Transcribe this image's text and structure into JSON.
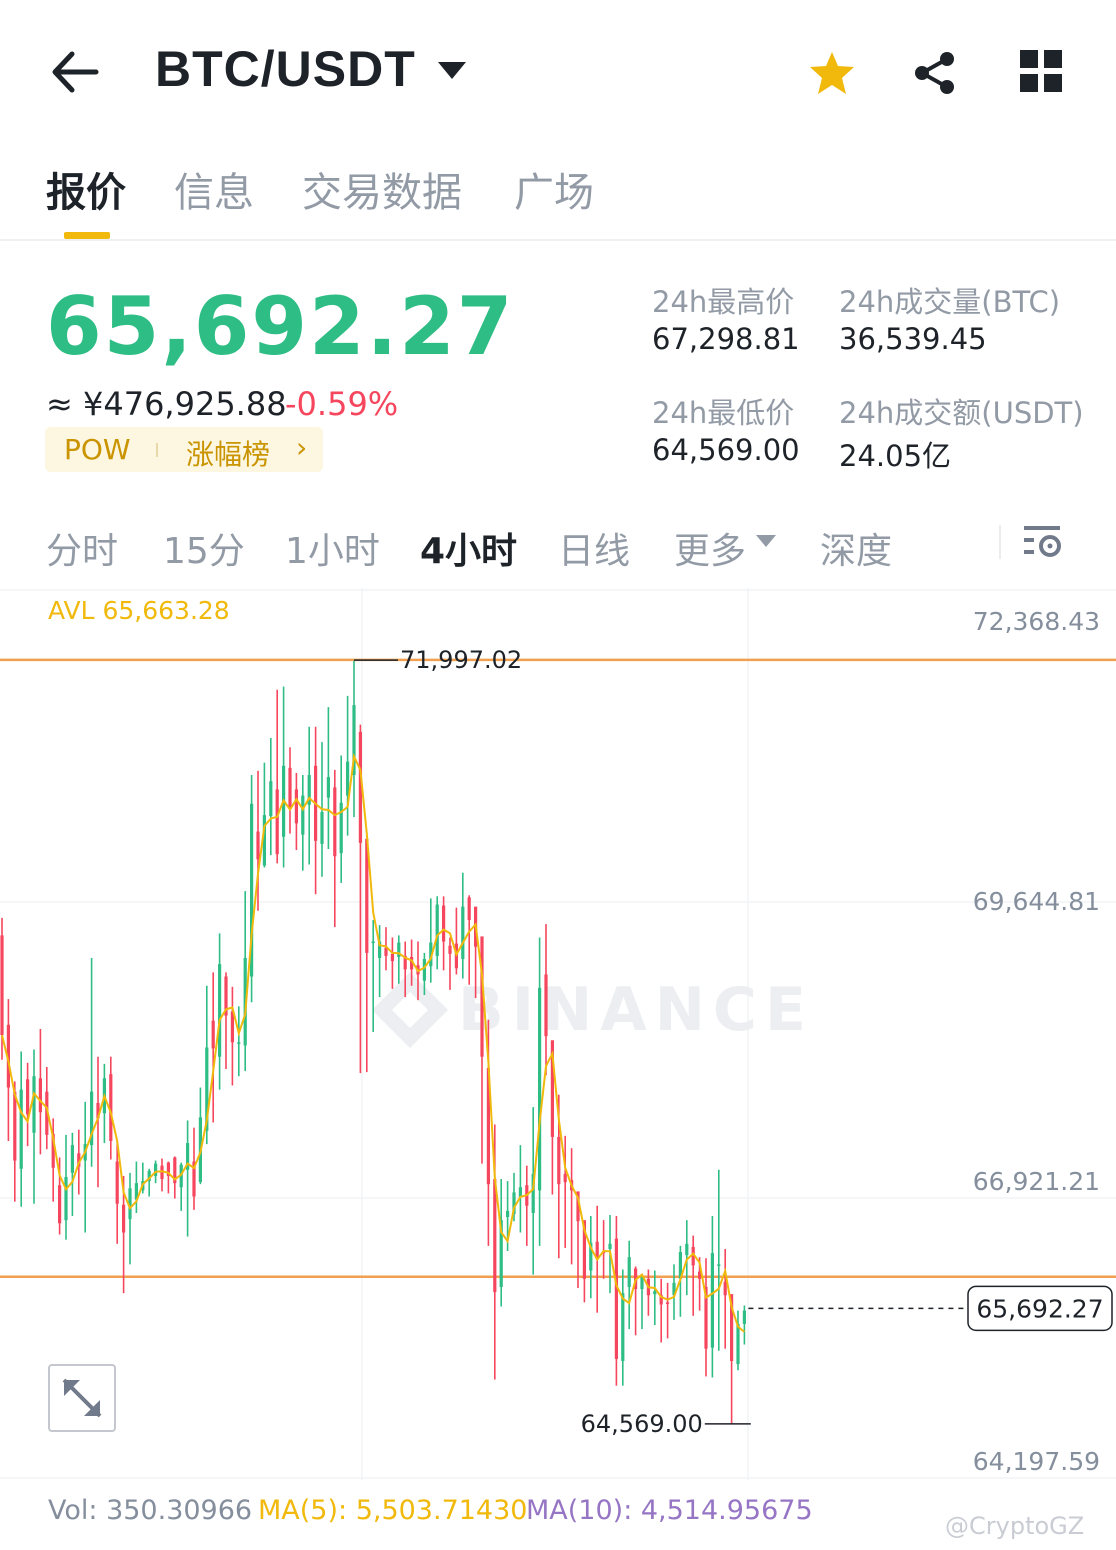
{
  "header": {
    "back_icon": "arrow-left-icon",
    "pair": "BTC/USDT",
    "dropdown_icon": "caret-down-icon",
    "favorite_icon": "star-icon",
    "share_icon": "share-icon",
    "menu_icon": "grid-icon",
    "favorite_color": "#f0b90b"
  },
  "tabs": [
    {
      "label": "报价",
      "active": true
    },
    {
      "label": "信息",
      "active": false
    },
    {
      "label": "交易数据",
      "active": false
    },
    {
      "label": "广场",
      "active": false
    }
  ],
  "ticker": {
    "last_price": "65,692.27",
    "approx_cny": "≈ ¥476,925.88",
    "change_pct": "-0.59%",
    "tag_pow": "POW",
    "tag_gainers": "涨幅榜",
    "tag_arrow": "›",
    "high_label": "24h最高价",
    "high_value": "67,298.81",
    "vol_btc_label": "24h成交量(BTC)",
    "vol_btc_value": "36,539.45",
    "low_label": "24h最低价",
    "low_value": "64,569.00",
    "vol_usdt_label": "24h成交额(USDT)",
    "vol_usdt_value": "24.05亿",
    "up_color": "#2ebd85",
    "down_color": "#f6465d"
  },
  "intervals": [
    {
      "label": "分时",
      "active": false
    },
    {
      "label": "15分",
      "active": false
    },
    {
      "label": "1小时",
      "active": false
    },
    {
      "label": "4小时",
      "active": true
    },
    {
      "label": "日线",
      "active": false
    },
    {
      "label": "更多",
      "active": false
    },
    {
      "label": "深度",
      "active": false
    }
  ],
  "chart_settings_icon": "chart-settings-icon",
  "chart_data": {
    "type": "candlestick",
    "avl_label": "AVL 65,663.28",
    "y_ticks": [
      "72,368.43",
      "69,644.81",
      "66,921.21",
      "64,197.59"
    ],
    "ylim": [
      64197.59,
      72368.43
    ],
    "high_marker": "71,997.02",
    "low_marker": "64,569.00",
    "current_price": "65,692.27",
    "watermark": "BINANCE",
    "candles": [
      [
        69320,
        68350,
        69490,
        68110
      ],
      [
        68450,
        67840,
        68700,
        67320
      ],
      [
        67800,
        67130,
        67900,
        66730
      ],
      [
        67050,
        67820,
        68190,
        66680
      ],
      [
        67920,
        67580,
        68080,
        67270
      ],
      [
        67400,
        67950,
        68210,
        66710
      ],
      [
        67930,
        67600,
        68410,
        67190
      ],
      [
        67800,
        67380,
        68040,
        67240
      ],
      [
        67390,
        67060,
        67540,
        66730
      ],
      [
        66890,
        66520,
        67160,
        66410
      ],
      [
        66550,
        66970,
        67380,
        66360
      ],
      [
        67010,
        67280,
        67400,
        66590
      ],
      [
        67200,
        67070,
        67430,
        66800
      ],
      [
        67130,
        67290,
        67700,
        66430
      ],
      [
        67280,
        67800,
        69100,
        67070
      ],
      [
        67690,
        67540,
        68140,
        66870
      ],
      [
        67590,
        67930,
        68070,
        67300
      ],
      [
        67970,
        67320,
        68140,
        67140
      ],
      [
        67120,
        66710,
        67320,
        66320
      ],
      [
        66700,
        66430,
        66980,
        65840
      ],
      [
        66560,
        66860,
        67010,
        66120
      ],
      [
        66750,
        66910,
        67120,
        66620
      ],
      [
        66840,
        66930,
        67110,
        66810
      ],
      [
        66930,
        67030,
        67050,
        66780
      ],
      [
        66980,
        67100,
        67130,
        66910
      ],
      [
        67080,
        66950,
        67150,
        66830
      ],
      [
        67110,
        66980,
        67120,
        66810
      ],
      [
        67160,
        66910,
        67170,
        66760
      ],
      [
        66870,
        67090,
        67110,
        66640
      ],
      [
        67040,
        67300,
        67520,
        66390
      ],
      [
        67120,
        66780,
        67450,
        66650
      ],
      [
        66920,
        67550,
        67840,
        66900
      ],
      [
        67420,
        68230,
        68830,
        67290
      ],
      [
        68490,
        68220,
        68960,
        67500
      ],
      [
        68140,
        69040,
        69340,
        67820
      ],
      [
        68920,
        68540,
        68960,
        68020
      ],
      [
        68580,
        68280,
        68820,
        67860
      ],
      [
        68270,
        68280,
        68630,
        67950
      ],
      [
        68250,
        69100,
        69750,
        68000
      ],
      [
        68920,
        70600,
        70880,
        68670
      ],
      [
        70330,
        70060,
        70920,
        69560
      ],
      [
        70000,
        70490,
        71000,
        69980
      ],
      [
        70480,
        70820,
        71240,
        70100
      ],
      [
        70740,
        70110,
        71710,
        70020
      ],
      [
        70280,
        70970,
        71740,
        69980
      ],
      [
        70950,
        70550,
        71150,
        70310
      ],
      [
        70740,
        70410,
        70900,
        70150
      ],
      [
        70300,
        70680,
        70880,
        69950
      ],
      [
        70590,
        70880,
        71350,
        70010
      ],
      [
        70970,
        70240,
        71350,
        69720
      ],
      [
        70210,
        70520,
        71200,
        69890
      ],
      [
        70660,
        70860,
        71540,
        70160
      ],
      [
        70760,
        70090,
        70930,
        69400
      ],
      [
        70120,
        70610,
        71070,
        69830
      ],
      [
        70680,
        71010,
        71650,
        70290
      ],
      [
        70880,
        71560,
        71990,
        70470
      ],
      [
        71300,
        70220,
        71370,
        67980
      ],
      [
        70260,
        69150,
        70230,
        67990
      ],
      [
        69250,
        69260,
        69470,
        68380
      ],
      [
        69100,
        69260,
        69420,
        68720
      ],
      [
        69200,
        69120,
        69400,
        68980
      ],
      [
        69140,
        69070,
        69300,
        68800
      ],
      [
        69110,
        69250,
        69320,
        68850
      ],
      [
        69120,
        68990,
        69260,
        68720
      ],
      [
        69110,
        68990,
        69280,
        68830
      ],
      [
        69030,
        68940,
        69260,
        68690
      ],
      [
        68880,
        69090,
        69150,
        68740
      ],
      [
        69020,
        69250,
        69680,
        68860
      ],
      [
        69120,
        69620,
        69700,
        68990
      ],
      [
        69610,
        69260,
        69700,
        68980
      ],
      [
        69220,
        69140,
        69300,
        68790
      ],
      [
        69240,
        69000,
        69590,
        68940
      ],
      [
        69090,
        69600,
        69930,
        68900
      ],
      [
        69690,
        69470,
        69710,
        68840
      ],
      [
        69600,
        69210,
        69430,
        68710
      ],
      [
        69310,
        68140,
        69300,
        67100
      ],
      [
        68030,
        66900,
        68500,
        66300
      ],
      [
        66950,
        65850,
        67480,
        65000
      ],
      [
        65900,
        66550,
        66950,
        65710
      ],
      [
        66580,
        66640,
        66930,
        66250
      ],
      [
        66610,
        66820,
        67010,
        66540
      ],
      [
        66770,
        66870,
        67280,
        66430
      ],
      [
        66890,
        66690,
        67080,
        66300
      ],
      [
        66620,
        67000,
        67650,
        66020
      ],
      [
        66840,
        68810,
        69300,
        66300
      ],
      [
        68940,
        68340,
        69430,
        67960
      ],
      [
        68300,
        67360,
        68120,
        66800
      ],
      [
        67360,
        66900,
        67770,
        66180
      ],
      [
        67000,
        66920,
        67370,
        66280
      ],
      [
        66940,
        66840,
        67250,
        66120
      ],
      [
        66830,
        66540,
        66750,
        65890
      ],
      [
        66550,
        65980,
        66450,
        65750
      ],
      [
        66060,
        66330,
        66590,
        65790
      ],
      [
        66340,
        66190,
        66690,
        65650
      ],
      [
        66250,
        66230,
        66550,
        65980
      ],
      [
        66270,
        66320,
        66600,
        65840
      ],
      [
        66370,
        65200,
        66590,
        64940
      ],
      [
        65180,
        65840,
        66070,
        64940
      ],
      [
        65900,
        66190,
        66350,
        65490
      ],
      [
        66080,
        65880,
        66100,
        65430
      ],
      [
        65880,
        65990,
        66020,
        65490
      ],
      [
        65980,
        65820,
        66070,
        65620
      ],
      [
        65830,
        65860,
        66060,
        65530
      ],
      [
        65820,
        65730,
        65980,
        65360
      ],
      [
        65750,
        65740,
        65940,
        65400
      ],
      [
        65820,
        65940,
        66120,
        65580
      ],
      [
        65980,
        66240,
        66300,
        65610
      ],
      [
        66210,
        66320,
        66550,
        65820
      ],
      [
        66290,
        66110,
        66400,
        65620
      ],
      [
        66050,
        65980,
        66190,
        65670
      ],
      [
        65900,
        65300,
        66180,
        65030
      ],
      [
        65310,
        66230,
        66590,
        65020
      ],
      [
        66120,
        66120,
        67040,
        65280
      ],
      [
        65950,
        65820,
        66270,
        65300
      ],
      [
        65830,
        65180,
        65830,
        64570
      ],
      [
        65150,
        65540,
        65670,
        65090
      ],
      [
        65540,
        65670,
        65720,
        65340
      ]
    ],
    "avg_line_color": "#f0b90b",
    "level_lines": [
      72000,
      66000
    ],
    "level_line_color": "#f0a050"
  },
  "volume_bar": {
    "vol": "Vol: 350.30966",
    "ma5": "MA(5): 5,503.71430",
    "ma10": "MA(10): 4,514.95675",
    "ma5_color": "#f0b90b",
    "ma10_color": "#9675c4"
  },
  "expand_icon": "expand-icon",
  "credit": "@CryptoGZ"
}
